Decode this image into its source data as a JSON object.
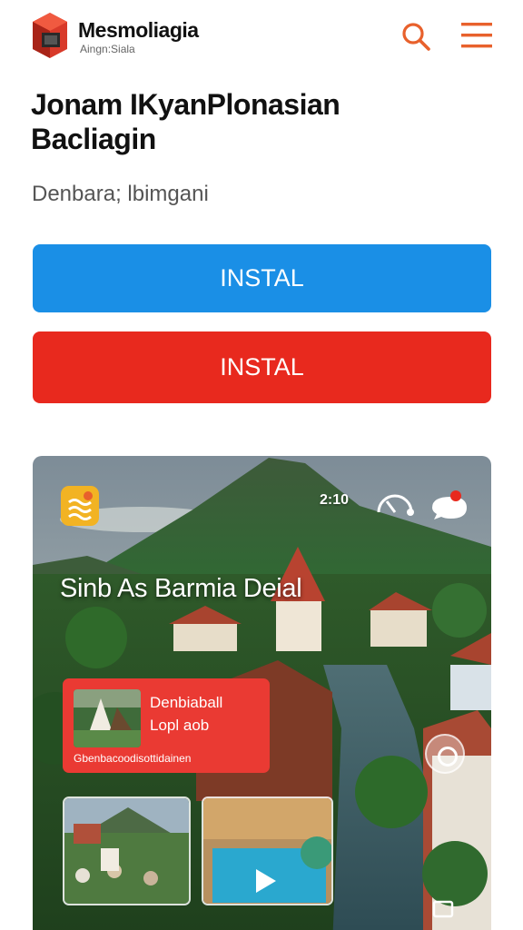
{
  "header": {
    "brand_name": "Mesmoliagia",
    "brand_sub": "Aingn:Siala",
    "search_icon": "search-icon",
    "menu_icon": "hamburger-menu-icon"
  },
  "page": {
    "title_line1": "Jonam IKyanPlonasian",
    "title_line2": "Bacliagin",
    "subtitle": "Denbara; lbimgani"
  },
  "buttons": {
    "install_blue": "INSTAL",
    "install_red": "INSTAL"
  },
  "card": {
    "title": "Sinb As Barmia Deial",
    "number": "2:10",
    "promo": {
      "line1": "Denbiaball",
      "line2": "Lopl aob",
      "line3": "Gbenbacoodisottidainen"
    }
  },
  "colors": {
    "accent_orange": "#e8612c",
    "button_blue": "#1a8fe6",
    "button_red": "#e8291e",
    "promo_red": "#ea3a33",
    "badge_yellow": "#f2b323"
  }
}
